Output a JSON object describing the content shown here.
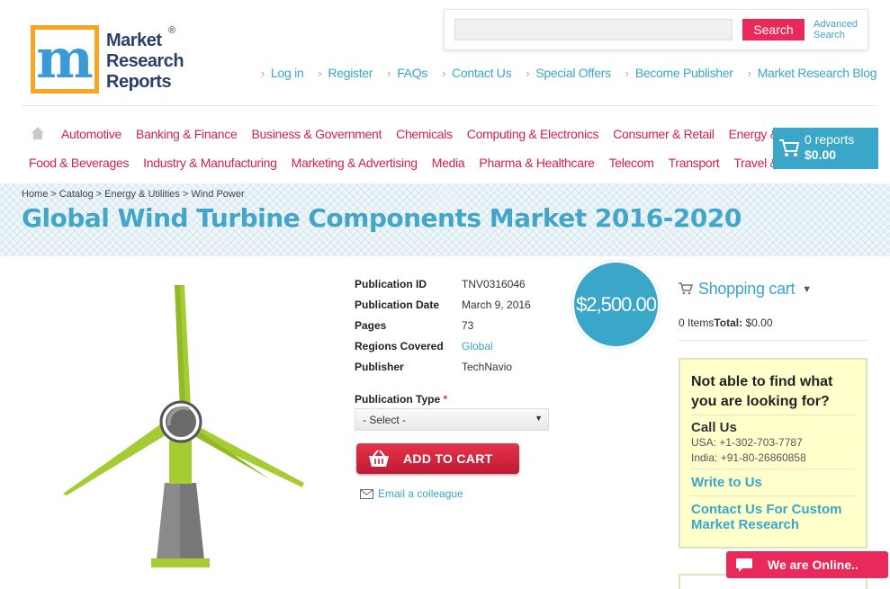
{
  "brand": {
    "logo_letter": "m",
    "name_lines": [
      "Market",
      "Research",
      "Reports"
    ],
    "reg_mark": "®"
  },
  "search": {
    "placeholder": "",
    "button_label": "Search",
    "advanced_label": "Advanced Search"
  },
  "top_links": [
    "Log in",
    "Register",
    "FAQs",
    "Contact Us",
    "Special Offers",
    "Become Publisher",
    "Market Research Blog"
  ],
  "categories_row1": [
    "Automotive",
    "Banking & Finance",
    "Business & Government",
    "Chemicals",
    "Computing & Electronics",
    "Consumer & Retail",
    "Energy & Utilities"
  ],
  "categories_row2": [
    "Food & Beverages",
    "Industry & Manufacturing",
    "Marketing & Advertising",
    "Media",
    "Pharma & Healthcare",
    "Telecom",
    "Transport",
    "Travel & Leisure"
  ],
  "cart_button": {
    "reports": "0 reports",
    "amount": "$0.00"
  },
  "breadcrumb": [
    "Home",
    "Catalog",
    "Energy & Utilities",
    "Wind Power"
  ],
  "page_title": "Global Wind Turbine Components Market 2016-2020",
  "details": [
    {
      "label": "Publication ID",
      "value": "TNV0316046"
    },
    {
      "label": "Publication Date",
      "value": "March 9, 2016"
    },
    {
      "label": "Pages",
      "value": "73"
    },
    {
      "label": "Regions Covered",
      "value": "Global"
    },
    {
      "label": "Publisher",
      "value": "TechNavio"
    }
  ],
  "price": "$2,500.00",
  "publication_type": {
    "label": "Publication Type",
    "required_mark": "*",
    "selected": "- Select -"
  },
  "add_to_cart_label": "ADD TO CART",
  "email_colleague_label": "Email a colleague",
  "shopping_cart": {
    "title": "Shopping cart",
    "items": "0 Items",
    "total_label": "Total:",
    "total_value": "$0.00"
  },
  "help": {
    "question": "Not able to find what you are looking for?",
    "call_heading": "Call Us",
    "phone_usa": "USA: +1-302-703-7787",
    "phone_india": "India: +91-80-26860858",
    "write_link": "Write to Us",
    "custom_link": "Contact Us For Custom Market Research"
  },
  "chat_label": "We are Online..",
  "colors": {
    "accent_blue": "#3aa7c9",
    "accent_red": "#e8295a",
    "turbine_green": "#a5cc32"
  }
}
